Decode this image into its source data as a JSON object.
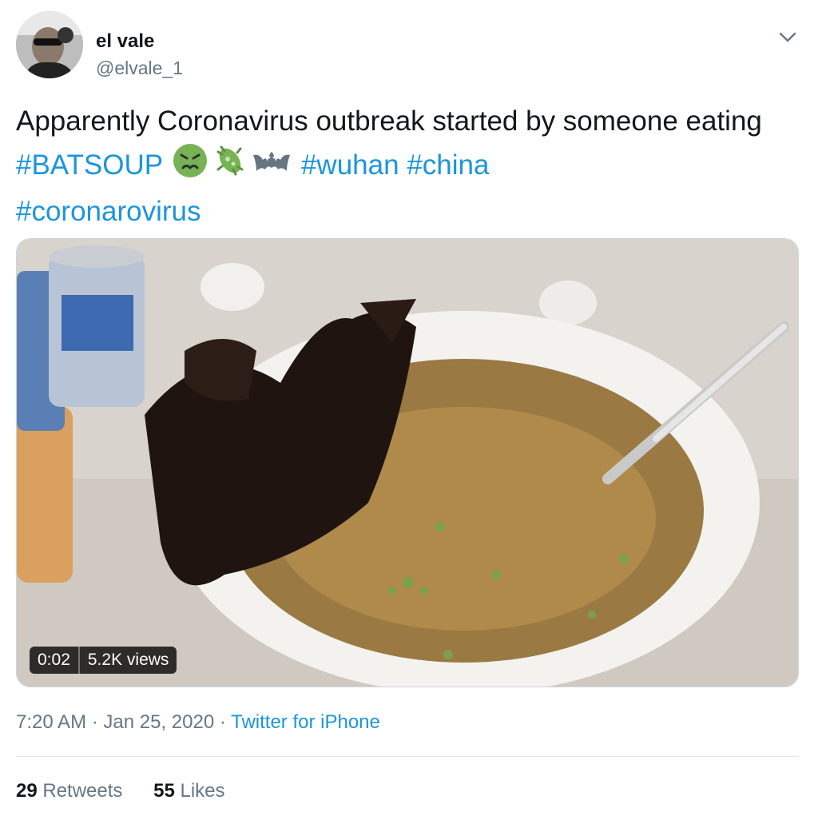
{
  "user": {
    "display_name": "el vale",
    "handle": "@elvale_1"
  },
  "tweet": {
    "text_before": "Apparently Coronavirus outbreak started by someone eating ",
    "hashtags": [
      "#BATSOUP",
      "#wuhan",
      "#china",
      "#coronarovirus"
    ],
    "emojis": [
      "nauseated-face",
      "microbe",
      "bat"
    ]
  },
  "video": {
    "duration": "0:02",
    "views": "5.2K views"
  },
  "meta": {
    "time": "7:20 AM",
    "date": "Jan 25, 2020",
    "separator": "·",
    "source": "Twitter for iPhone"
  },
  "stats": {
    "retweets_count": "29",
    "retweets_label": "Retweets",
    "likes_count": "55",
    "likes_label": "Likes"
  },
  "colors": {
    "link": "#1b95e0",
    "secondary_text": "#657786",
    "primary_text": "#14171a"
  }
}
